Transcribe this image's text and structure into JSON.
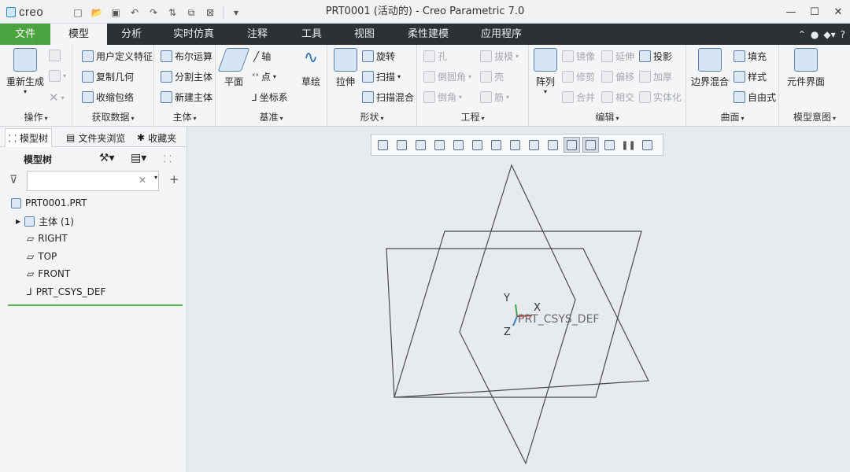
{
  "app": {
    "logo_text": "creo",
    "window_title": "PRT0001 (活动的) - Creo Parametric 7.0",
    "quick_access_icons": [
      "new-icon",
      "open-icon",
      "save-icon",
      "undo-icon",
      "redo-icon",
      "regenerate-icon",
      "windows-icon",
      "close-window-icon",
      "customize-icon"
    ]
  },
  "tabs": {
    "file": "文件",
    "items": [
      "模型",
      "分析",
      "实时仿真",
      "注释",
      "工具",
      "视图",
      "柔性建模",
      "应用程序"
    ],
    "active": "模型"
  },
  "ribbon": {
    "operations": {
      "label": "操作",
      "regenerate": "重新生成"
    },
    "get_data": {
      "label": "获取数据",
      "user_feature": "用户定义特征",
      "copy_geometry": "复制几何",
      "shrinkwrap": "收缩包络"
    },
    "body": {
      "label": "主体",
      "boolean": "布尔运算",
      "split_body": "分割主体",
      "new_body": "新建主体"
    },
    "datum": {
      "label": "基准",
      "plane": "平面",
      "axis": "轴",
      "point": "点",
      "csys": "坐标系",
      "sketch": "草绘"
    },
    "shapes": {
      "label": "形状",
      "extrude": "拉伸",
      "revolve": "旋转",
      "sweep": "扫描",
      "swept_blend": "扫描混合"
    },
    "engineering": {
      "label": "工程",
      "hole": "孔",
      "round": "倒圆角",
      "chamfer": "倒角",
      "draft": "拔模",
      "shell": "壳",
      "rib": "筋"
    },
    "editing": {
      "label": "编辑",
      "pattern": "阵列",
      "mirror": "镜像",
      "extend": "延伸",
      "project": "投影",
      "trim": "修剪",
      "offset": "偏移",
      "thicken": "加厚",
      "merge": "合并",
      "intersect": "相交",
      "solidify": "实体化"
    },
    "surfaces": {
      "label": "曲面",
      "boundary_blend": "边界混合",
      "fill": "填充",
      "style": "样式",
      "freestyle": "自由式"
    },
    "model_intent": {
      "label": "模型意图",
      "component_interface": "元件界面"
    }
  },
  "panel": {
    "tabs": [
      "模型树",
      "文件夹浏览",
      "收藏夹"
    ],
    "model_tree_title": "模型树",
    "search_placeholder": "",
    "tree_items": [
      "PRT0001.PRT",
      "主体 (1)",
      "RIGHT",
      "TOP",
      "FRONT",
      "PRT_CSYS_DEF"
    ]
  },
  "viewport": {
    "csys_label": "PRT_CSYS_DEF",
    "axis_labels": {
      "x": "X",
      "y": "Y",
      "z": "Z"
    }
  }
}
